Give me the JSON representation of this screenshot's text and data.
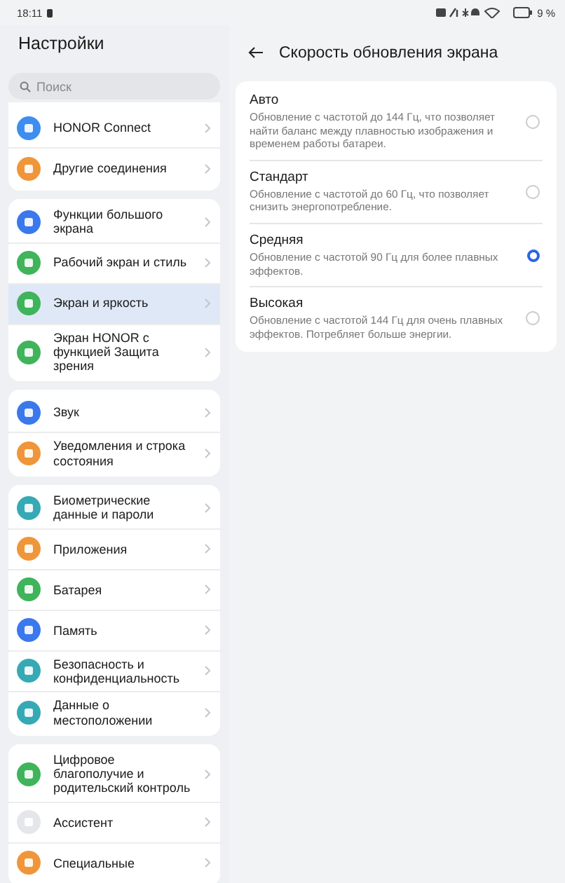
{
  "status_bar": {
    "time": "18:11",
    "battery": "9 %"
  },
  "sidebar": {
    "title": "Настройки",
    "search": {
      "placeholder": "Поиск"
    },
    "groups": [
      {
        "items": [
          {
            "label": "HONOR Connect",
            "color": "#3d8ef0",
            "selected": false
          },
          {
            "label": "Другие соединения",
            "color": "#f0963a",
            "selected": false
          }
        ]
      },
      {
        "items": [
          {
            "label": "Функции большого экрана",
            "color": "#3a78ee",
            "selected": false
          },
          {
            "label": "Рабочий экран и стиль",
            "color": "#3fb45a",
            "selected": false
          },
          {
            "label": "Экран и яркость",
            "color": "#3fb45a",
            "selected": true
          },
          {
            "label": "Экран HONOR с функцией Защита зрения",
            "color": "#3fb45a",
            "selected": false
          }
        ]
      },
      {
        "items": [
          {
            "label": "Звук",
            "color": "#3a78ee",
            "selected": false
          },
          {
            "label": "Уведомления и строка состояния",
            "color": "#f0963a",
            "selected": false
          }
        ]
      },
      {
        "items": [
          {
            "label": "Биометрические данные и пароли",
            "color": "#35aab5",
            "selected": false
          },
          {
            "label": "Приложения",
            "color": "#f0963a",
            "selected": false
          },
          {
            "label": "Батарея",
            "color": "#3fb45a",
            "selected": false
          },
          {
            "label": "Память",
            "color": "#3a78ee",
            "selected": false
          },
          {
            "label": "Безопасность и конфиденциальность",
            "color": "#35aab5",
            "selected": false
          },
          {
            "label": "Данные о местоположении",
            "color": "#35aab5",
            "selected": false
          }
        ]
      },
      {
        "items": [
          {
            "label": "Цифровое благополучие и родительский контроль",
            "color": "#3fb45a",
            "selected": false
          },
          {
            "label": "Ассистент",
            "color": "#e4e6ea",
            "selected": false
          },
          {
            "label": "Специальные",
            "color": "#f0963a",
            "selected": false
          }
        ]
      }
    ]
  },
  "page": {
    "title": "Скорость обновления экрана",
    "options": [
      {
        "title": "Авто",
        "description": "Обновление с частотой до 144 Гц, что позволяет найти баланс между плавностью изображения и временем работы батареи.",
        "selected": false
      },
      {
        "title": "Стандарт",
        "description": "Обновление с частотой до 60 Гц, что позволяет снизить энергопотребление.",
        "selected": false
      },
      {
        "title": "Средняя",
        "description": "Обновление с частотой 90 Гц для более плавных эффектов.",
        "selected": true
      },
      {
        "title": "Высокая",
        "description": "Обновление с частотой 144 Гц для очень плавных эффектов. Потребляет больше энергии.",
        "selected": false
      }
    ]
  }
}
